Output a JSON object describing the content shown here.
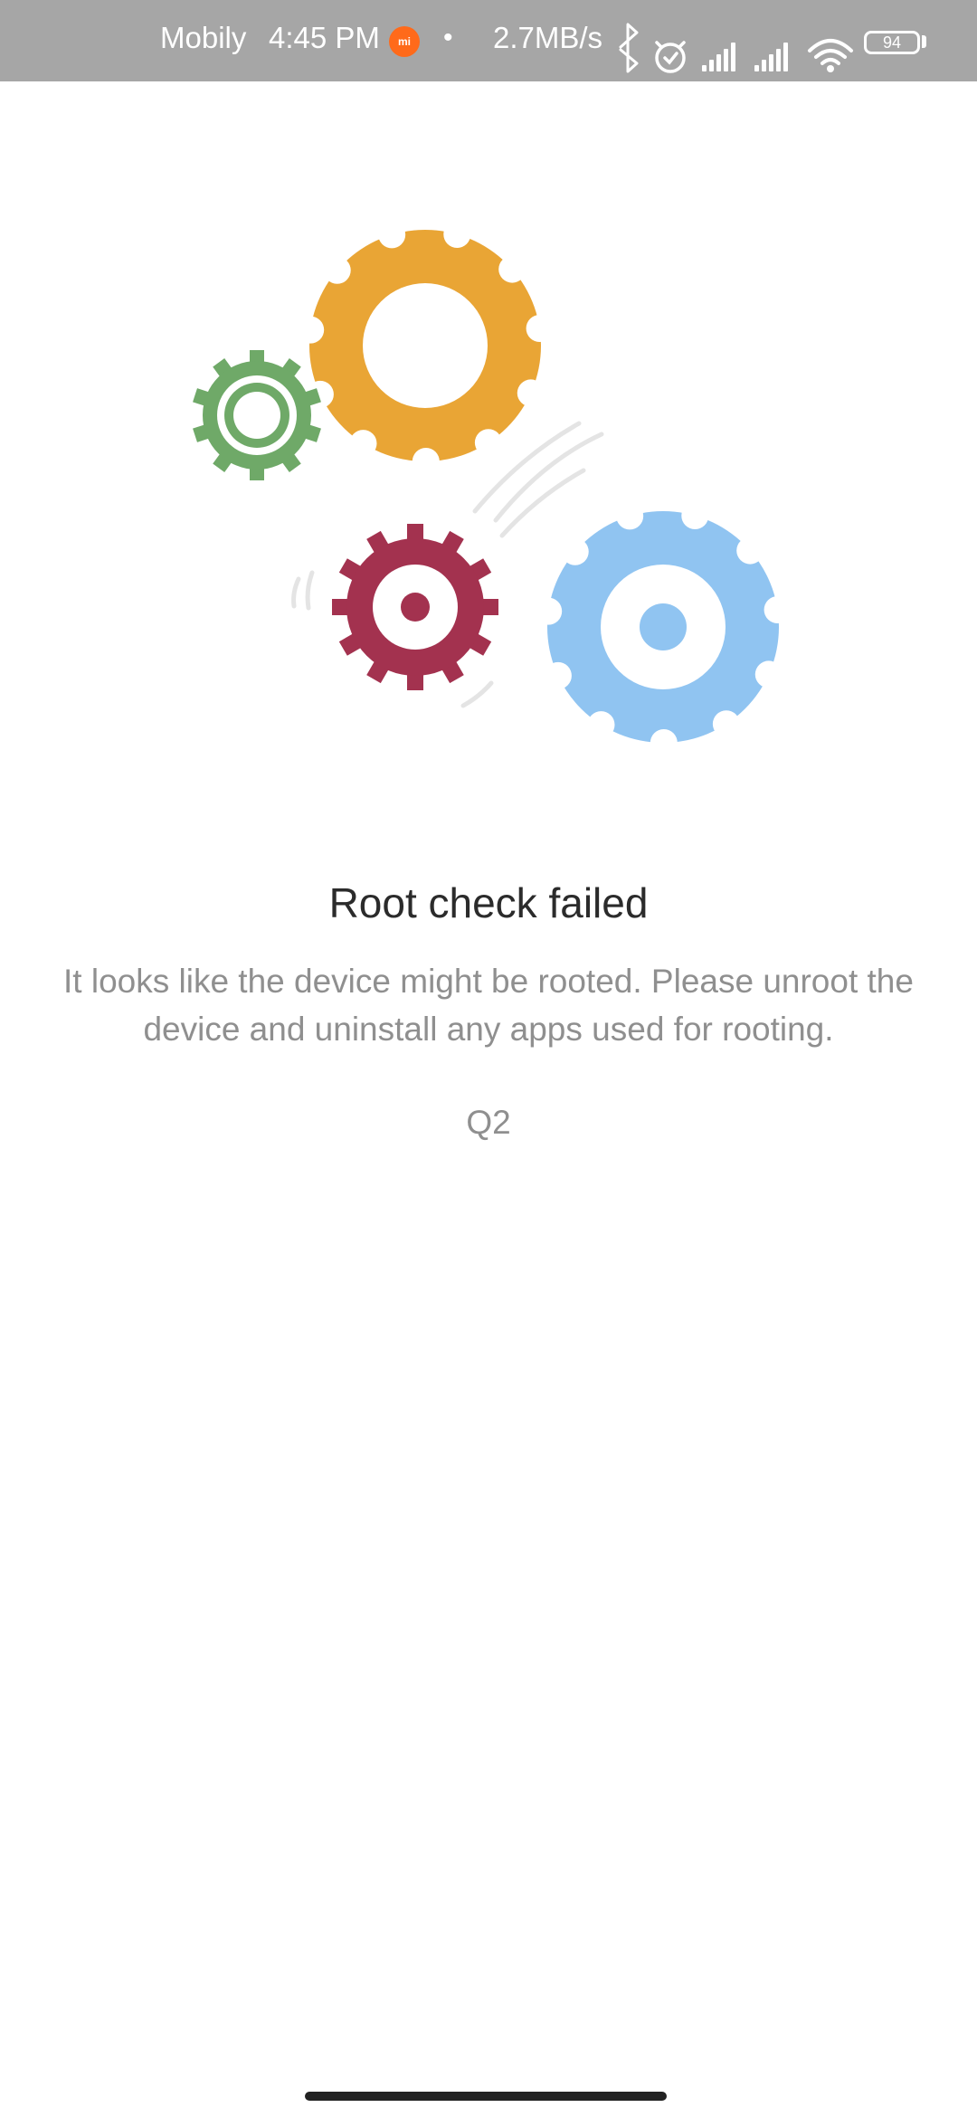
{
  "status_bar": {
    "carrier": "Mobily",
    "time": "4:45 PM",
    "separator": "•",
    "network_speed": "2.7MB/s",
    "notification_app_icon": "mi-app-icon",
    "icons": [
      "bluetooth-icon",
      "alarm-icon",
      "signal-icon",
      "signal-icon",
      "wifi-icon",
      "battery-icon"
    ],
    "battery_level": "94",
    "background_color": "#a6a6a6"
  },
  "illustration": {
    "name": "gears-illustration",
    "gear_colors": {
      "orange": "#e9a535",
      "green": "#6fa968",
      "red": "#a3324f",
      "blue": "#90c4f1"
    }
  },
  "root_check": {
    "title": "Root check failed",
    "message": "It looks like the device might be rooted. Please unroot the device and uninstall any apps used for rooting.",
    "code": "Q2"
  }
}
